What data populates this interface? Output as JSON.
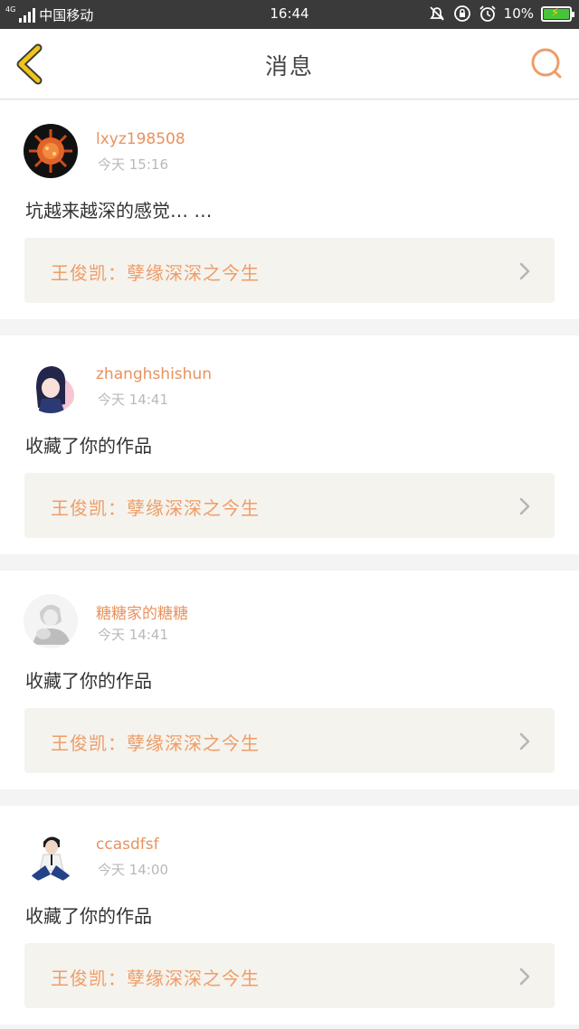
{
  "status_bar": {
    "network": "4G",
    "carrier": "中国移动",
    "time": "16:44",
    "battery": "10%"
  },
  "header": {
    "title": "消息"
  },
  "colors": {
    "accent": "#ef9d67",
    "back_arrow": "#f0c419",
    "card_link_bg": "#f4f3ee"
  },
  "messages": [
    {
      "username": "lxyz198508",
      "time": "今天 15:16",
      "content": "坑越来越深的感觉… …",
      "work_title": "王俊凯：孽缘深深之今生",
      "avatar_icon": "avatar-virus-icon"
    },
    {
      "username": "zhanghshishun",
      "time": "今天 14:41",
      "content": "收藏了你的作品",
      "work_title": "王俊凯：孽缘深深之今生",
      "avatar_icon": "avatar-anime-girl-icon"
    },
    {
      "username": "糖糖家的糖糖",
      "time": "今天 14:41",
      "content": "收藏了你的作品",
      "work_title": "王俊凯：孽缘深深之今生",
      "avatar_icon": "avatar-sketch-icon"
    },
    {
      "username": "ccasdfsf",
      "time": "今天 14:00",
      "content": "收藏了你的作品",
      "work_title": "王俊凯：孽缘深深之今生",
      "avatar_icon": "avatar-person-icon"
    }
  ]
}
